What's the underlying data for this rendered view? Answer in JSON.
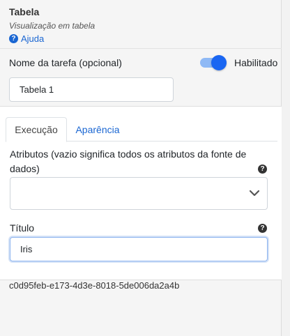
{
  "header": {
    "title": "Tabela",
    "subtitle": "Visualização em tabela",
    "help_label": "Ajuda"
  },
  "task_name": {
    "label": "Nome da tarefa (opcional)",
    "value": "Tabela 1",
    "toggle_label": "Habilitado",
    "toggle_on": true
  },
  "tabs": [
    {
      "label": "Execução",
      "active": true
    },
    {
      "label": "Aparência",
      "active": false
    }
  ],
  "attributes": {
    "label": "Atributos (vazio significa todos os atributos da fonte de dados)",
    "selected": ""
  },
  "title_field": {
    "label": "Título",
    "value": "Iris"
  },
  "uuid": "c0d95feb-e173-4d3e-8018-5de006da2a4b",
  "colors": {
    "accent": "#1a66d2",
    "toggle_on": "#1a66f2",
    "toggle_track": "#8fb9f5"
  },
  "icons": {
    "help": "question-circle-icon",
    "select": "chevron-down-icon"
  }
}
